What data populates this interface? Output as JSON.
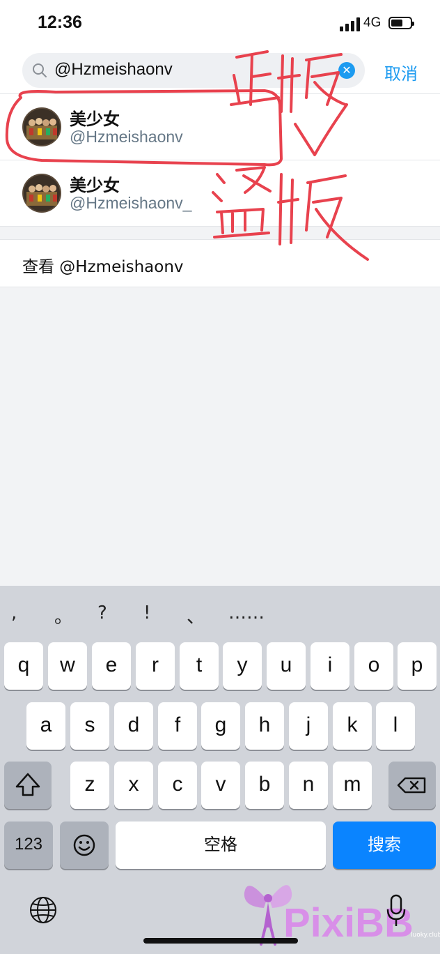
{
  "status_bar": {
    "time": "12:36",
    "network": "4G",
    "battery_level": 0.6
  },
  "search": {
    "query": "@Hzmeishaonv",
    "clear_icon": "clear-icon",
    "cancel_label": "取消"
  },
  "results": [
    {
      "name": "美少女",
      "handle": "@Hzmeishaonv"
    },
    {
      "name": "美少女",
      "handle": "@Hzmeishaonv_"
    }
  ],
  "view_row": {
    "label": "查看 @Hzmeishaonv"
  },
  "annotations": {
    "marker_color": "#e8424e",
    "genuine_text": "正版",
    "pirated_text": "盗版"
  },
  "keyboard": {
    "punctuation": [
      ",",
      "。",
      "?",
      "!",
      "、",
      "……"
    ],
    "row1": [
      "q",
      "w",
      "e",
      "r",
      "t",
      "y",
      "u",
      "i",
      "o",
      "p"
    ],
    "row2": [
      "a",
      "s",
      "d",
      "f",
      "g",
      "h",
      "j",
      "k",
      "l"
    ],
    "row3": [
      "z",
      "x",
      "c",
      "v",
      "b",
      "n",
      "m"
    ],
    "numbers_label": "123",
    "space_label": "空格",
    "search_label": "搜索",
    "accent_color": "#0a84ff"
  },
  "watermark": {
    "brand": "PixiBB",
    "small_text": "luoky.club"
  }
}
